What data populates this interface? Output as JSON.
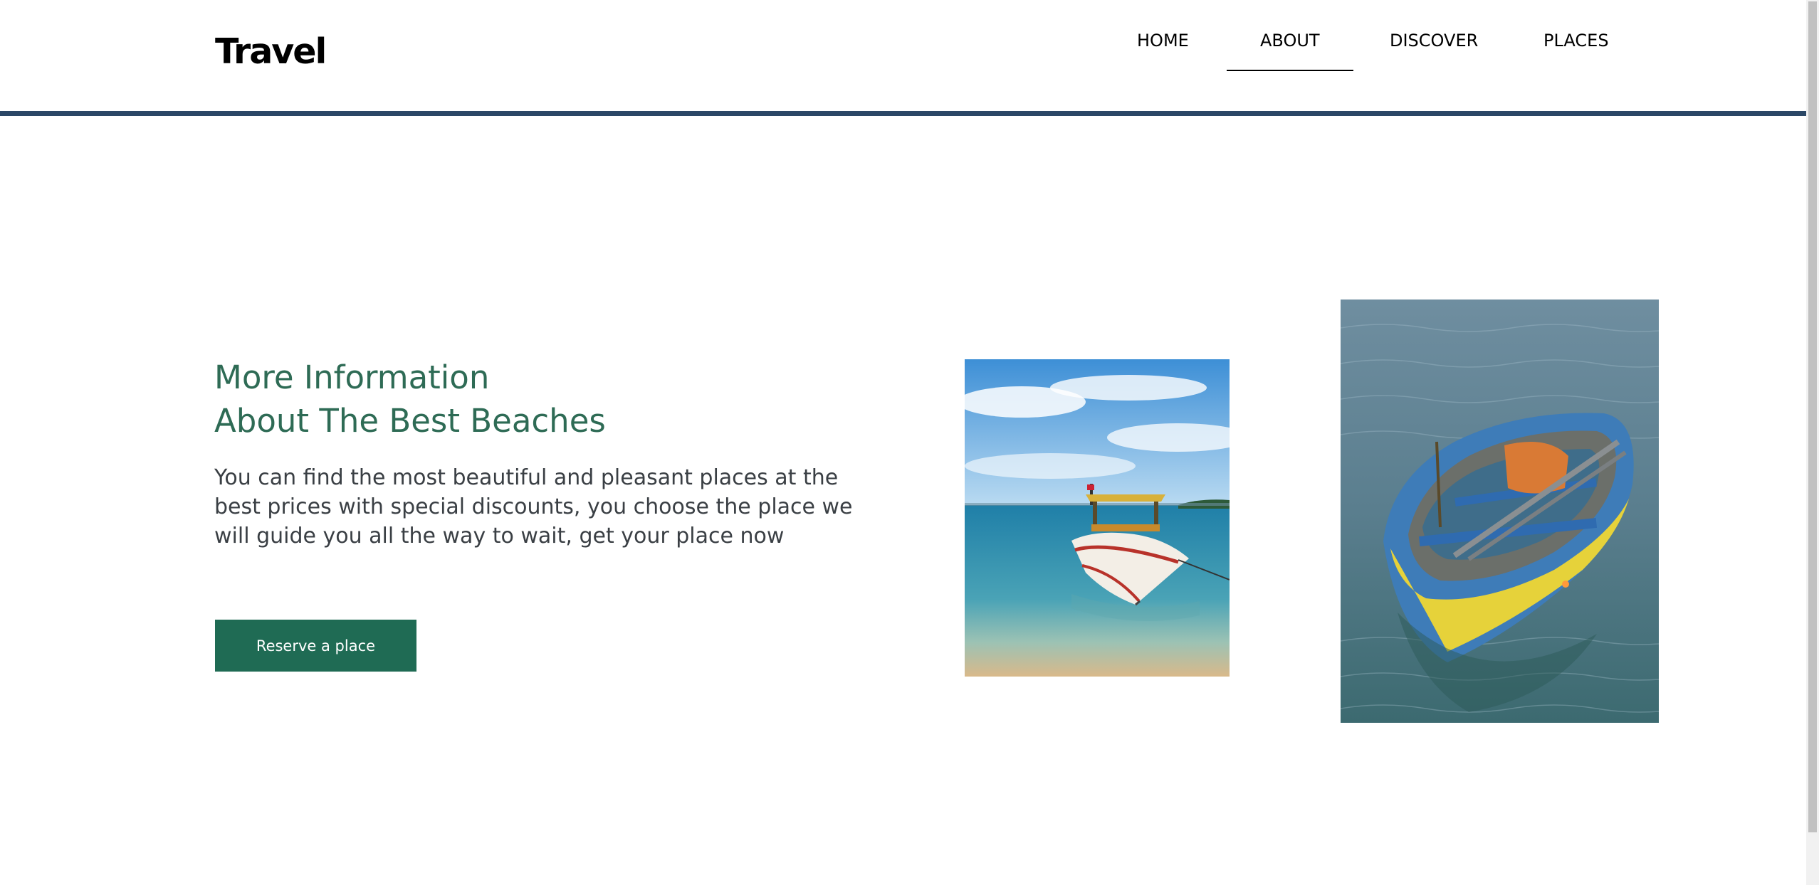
{
  "header": {
    "logo": "Travel",
    "nav": [
      {
        "label": "HOME"
      },
      {
        "label": "ABOUT",
        "active": true
      },
      {
        "label": "DISCOVER"
      },
      {
        "label": "PLACES"
      }
    ],
    "border_color": "#2b4766"
  },
  "main": {
    "heading_line1": "More Information",
    "heading_line2": "About The Best Beaches",
    "description": "You can find the most beautiful and pleasant places at the best prices with special discounts, you choose the place we will guide you all the way to wait, get your place now",
    "cta_label": "Reserve a place",
    "heading_color": "#2e6b55",
    "cta_color": "#1f6b54"
  },
  "images": [
    {
      "name": "boat-on-beach-photo"
    },
    {
      "name": "yellow-rowboat-photo"
    }
  ]
}
